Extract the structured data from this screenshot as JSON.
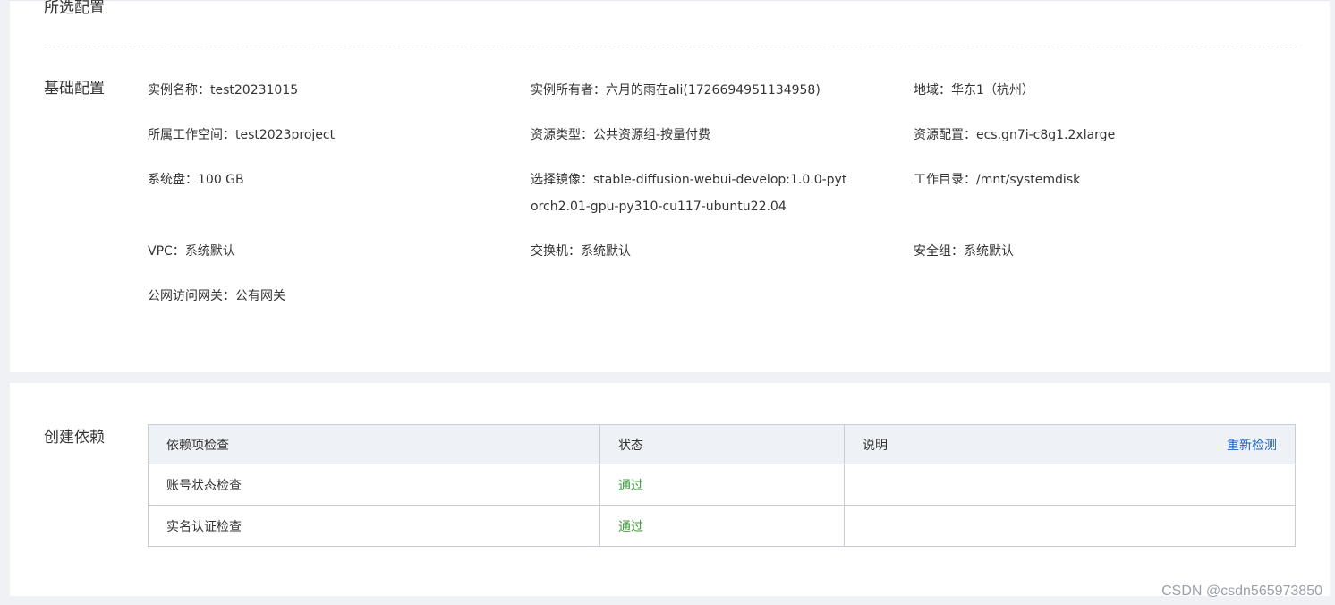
{
  "selected_config": {
    "title": "所选配置"
  },
  "basic_config": {
    "title": "基础配置",
    "fields": [
      {
        "label": "实例名称：",
        "value": "test20231015"
      },
      {
        "label": "实例所有者：",
        "value": "六月的雨在ali(1726694951134958)"
      },
      {
        "label": "地域：",
        "value": "华东1（杭州）"
      },
      {
        "label": "所属工作空间：",
        "value": "test2023project"
      },
      {
        "label": "资源类型：",
        "value": "公共资源组-按量付费"
      },
      {
        "label": "资源配置：",
        "value": "ecs.gn7i-c8g1.2xlarge"
      },
      {
        "label": "系统盘：",
        "value": "100 GB"
      },
      {
        "label": "选择镜像：",
        "value": "stable-diffusion-webui-develop:1.0.0-pytorch2.01-gpu-py310-cu117-ubuntu22.04"
      },
      {
        "label": "工作目录：",
        "value": "/mnt/systemdisk"
      },
      {
        "label": "VPC：",
        "value": "系统默认"
      },
      {
        "label": "交换机：",
        "value": "系统默认"
      },
      {
        "label": "安全组：",
        "value": "系统默认"
      },
      {
        "label": "公网访问网关：",
        "value": "公有网关"
      }
    ]
  },
  "dependencies": {
    "title": "创建依赖",
    "headers": {
      "item": "依赖项检查",
      "status": "状态",
      "note": "说明",
      "recheck": "重新检测"
    },
    "rows": [
      {
        "item": "账号状态检查",
        "status": "通过",
        "note": ""
      },
      {
        "item": "实名认证检查",
        "status": "通过",
        "note": ""
      }
    ]
  },
  "watermark": "CSDN @csdn565973850"
}
